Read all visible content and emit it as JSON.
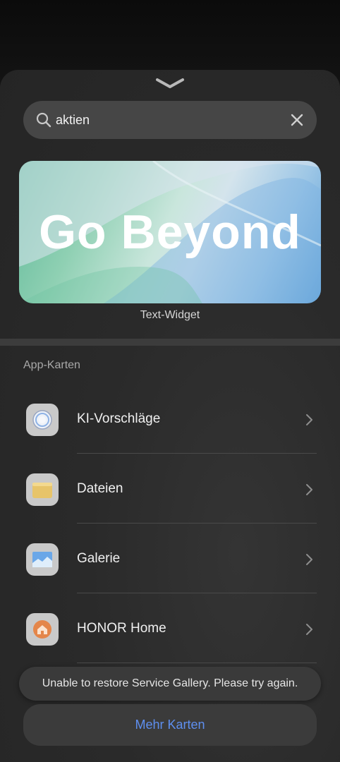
{
  "search": {
    "value": "aktien",
    "icon": "search-icon",
    "clear_icon": "close-icon"
  },
  "widget": {
    "hero_text": "Go Beyond",
    "caption": "Text-Widget"
  },
  "section": {
    "title": "App-Karten"
  },
  "app_cards": [
    {
      "label": "KI-Vorschläge",
      "icon": "ai-suggestions-icon"
    },
    {
      "label": "Dateien",
      "icon": "folder-icon"
    },
    {
      "label": "Galerie",
      "icon": "gallery-icon"
    },
    {
      "label": "HONOR Home",
      "icon": "home-icon"
    }
  ],
  "toast": {
    "message": "Unable to restore Service Gallery. Please try again."
  },
  "footer": {
    "more_label": "Mehr Karten"
  },
  "colors": {
    "accent": "#5e8ff0",
    "sheet_bg": "#2a2a2a"
  }
}
